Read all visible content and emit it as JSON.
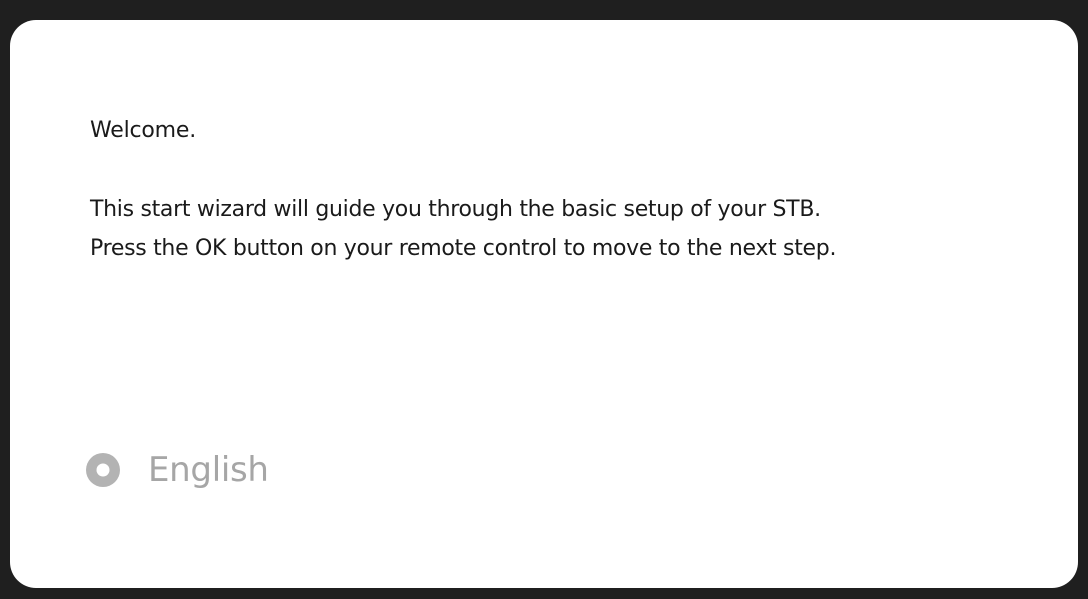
{
  "wizard": {
    "welcome_text": "Welcome.",
    "description_lines": [
      "This start wizard will guide you through the basic setup of your STB.",
      "Press the OK button on your remote control to move to the next step."
    ]
  },
  "language_selector": {
    "selected_label": "English",
    "icon": "radio-selected-icon",
    "label_color": "#a6a6a6",
    "icon_color": "#b3b3b3"
  }
}
